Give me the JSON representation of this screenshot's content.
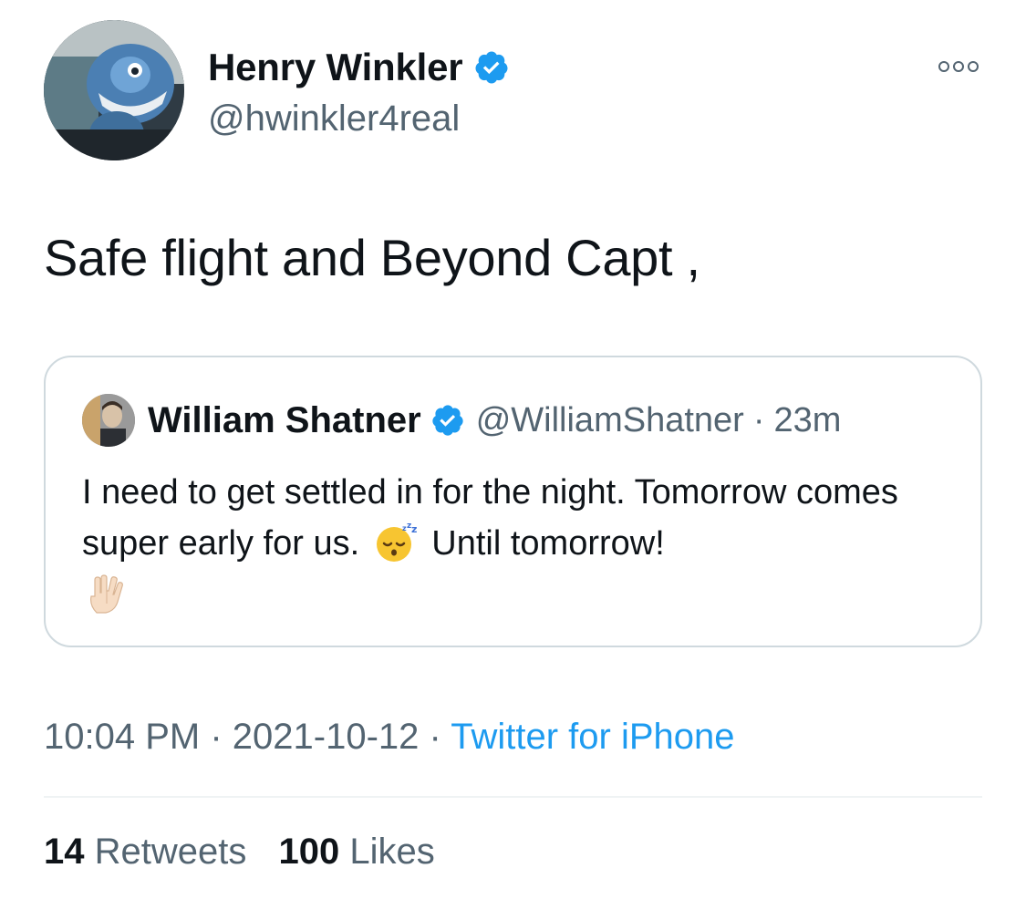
{
  "author": {
    "name": "Henry Winkler",
    "handle": "@hwinkler4real"
  },
  "tweet": {
    "text": "Safe flight and Beyond Capt ,"
  },
  "quote": {
    "name": "William Shatner",
    "handle": "@WilliamShatner",
    "separator": "·",
    "time": "23m",
    "text_part1": "I need to get settled in for the night. Tomorrow comes super early for us.",
    "text_part2": "Until tomorrow!",
    "emojis": [
      "sleeping-face",
      "vulcan-salute"
    ]
  },
  "meta": {
    "time": "10:04 PM",
    "separator": "·",
    "date": "2021-10-12",
    "source": "Twitter for iPhone"
  },
  "stats": {
    "retweets_count": "14",
    "retweets_label": "Retweets",
    "likes_count": "100",
    "likes_label": "Likes"
  },
  "colors": {
    "accent": "#1d9bf0",
    "text_primary": "#0f1419",
    "text_secondary": "#536471",
    "border": "#cfd9de"
  }
}
